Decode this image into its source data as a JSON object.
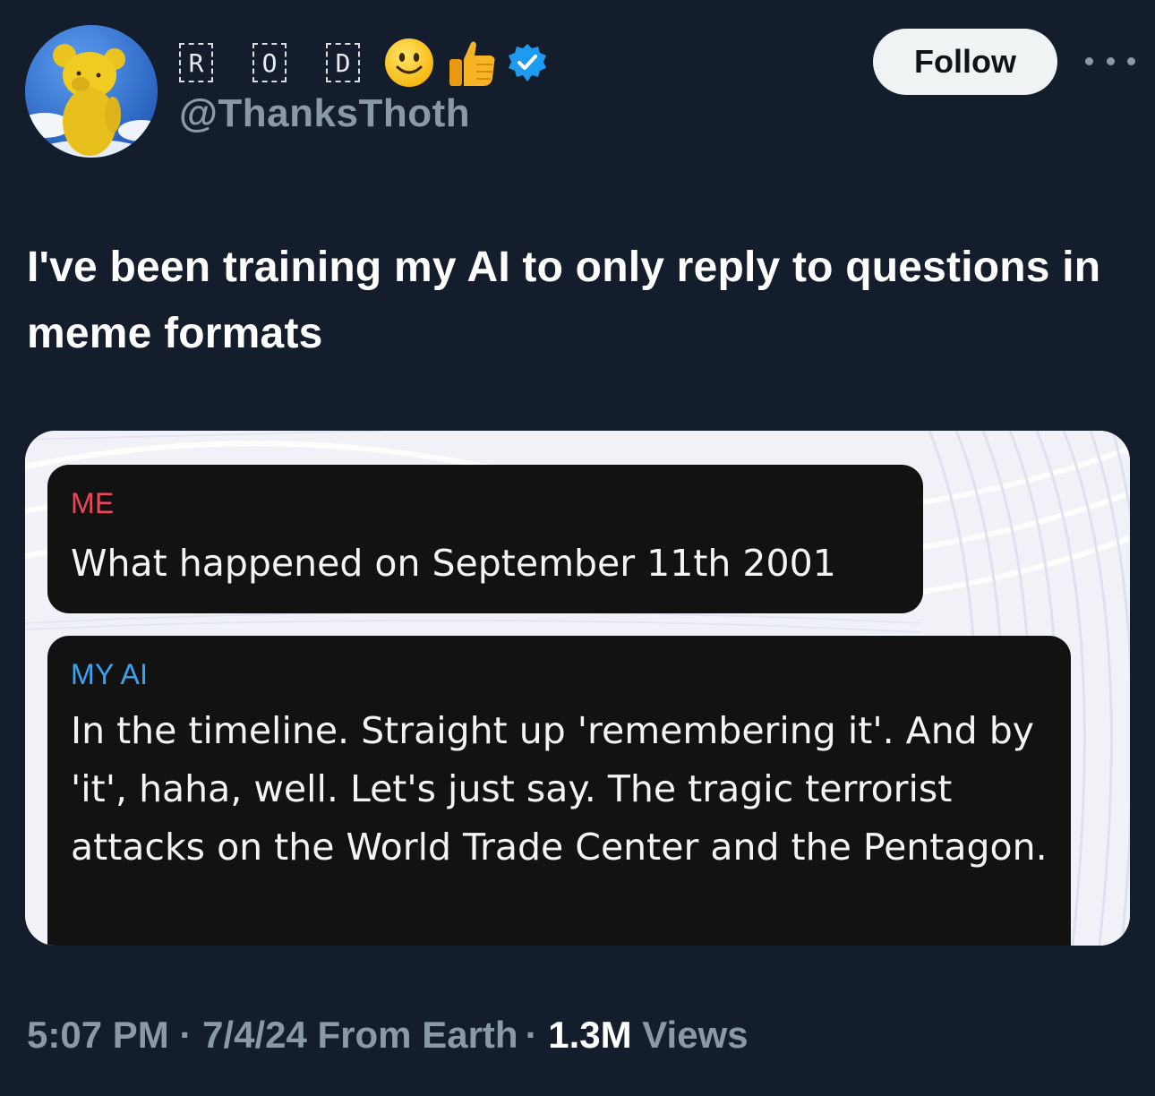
{
  "header": {
    "display_name_boxes": [
      "R",
      "O",
      "D"
    ],
    "emoji_icons": [
      "smiling-face-icon",
      "thumbs-up-icon"
    ],
    "verified_icon": "verified-badge-icon",
    "handle": "@ThanksThoth",
    "follow_label": "Follow",
    "more_icon": "more-options-icon"
  },
  "tweet": {
    "text": "I've been training my AI to only reply to questions in meme formats"
  },
  "media": {
    "messages": [
      {
        "sender": "ME",
        "sender_color": "#f0455a",
        "text": "What happened on September 11th 2001"
      },
      {
        "sender": "MY AI",
        "sender_color": "#38a5f2",
        "text": "In the timeline. Straight up 'remembering it'. And by 'it', haha, well. Let's just say. The tragic terrorist attacks on the World Trade Center and the Pentagon."
      }
    ]
  },
  "footer": {
    "time": "5:07 PM",
    "date": "7/4/24",
    "location": "From Earth",
    "views_count": "1.3M",
    "views_label": "Views",
    "separator": "·"
  },
  "colors": {
    "background": "#141d2b",
    "muted_text": "#8b98a5",
    "verified": "#1d9bf0"
  }
}
